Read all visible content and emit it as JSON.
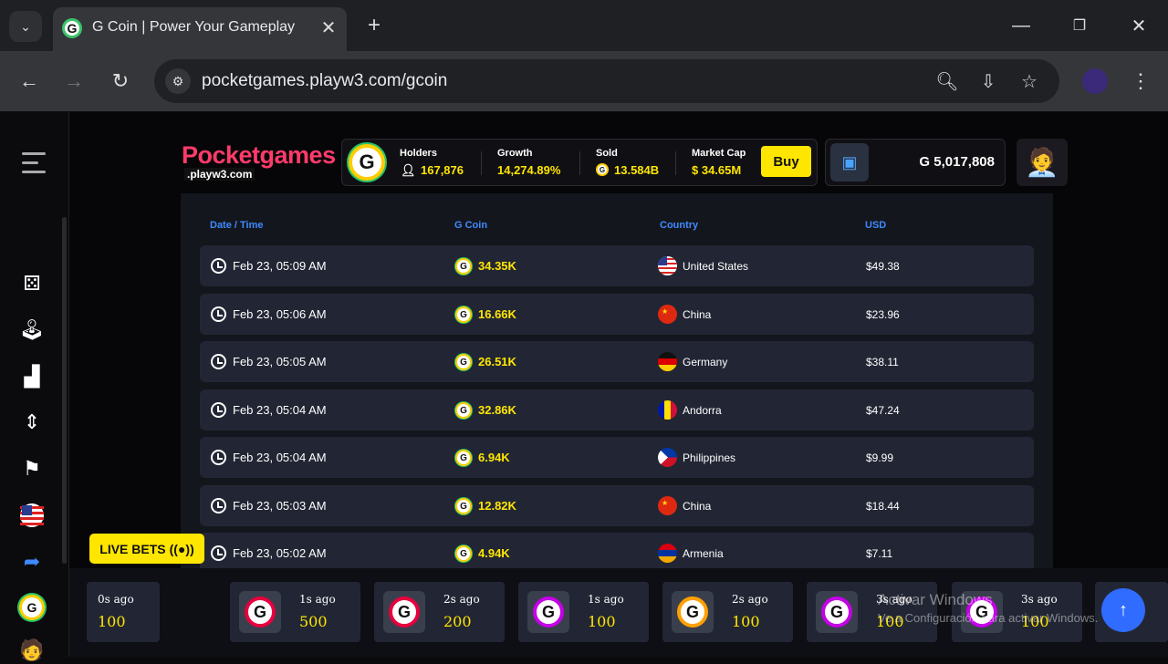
{
  "browser": {
    "tab_title": "G Coin | Power Your Gameplay",
    "url": "pocketgames.playw3.com/gcoin"
  },
  "header": {
    "logo_main": "Pocketgames",
    "logo_sub": ".playw3.com",
    "stats": {
      "holders_label": "Holders",
      "holders_value": "167,876",
      "growth_label": "Growth",
      "growth_value": "14,274.89%",
      "sold_label": "Sold",
      "sold_value": "13.584B",
      "marketcap_label": "Market Cap",
      "marketcap_value": "$ 34.65M"
    },
    "buy_label": "Buy",
    "wallet_balance": "G 5,017,808"
  },
  "table": {
    "headers": [
      "Date / Time",
      "G Coin",
      "Country",
      "USD"
    ],
    "rows": [
      {
        "date": "Feb 23, 05:09 AM",
        "coin": "34.35K",
        "country": "United States",
        "usd": "$49.38"
      },
      {
        "date": "Feb 23, 05:06 AM",
        "coin": "16.66K",
        "country": "China",
        "usd": "$23.96"
      },
      {
        "date": "Feb 23, 05:05 AM",
        "coin": "26.51K",
        "country": "Germany",
        "usd": "$38.11"
      },
      {
        "date": "Feb 23, 05:04 AM",
        "coin": "32.86K",
        "country": "Andorra",
        "usd": "$47.24"
      },
      {
        "date": "Feb 23, 05:04 AM",
        "coin": "6.94K",
        "country": "Philippines",
        "usd": "$9.99"
      },
      {
        "date": "Feb 23, 05:03 AM",
        "coin": "12.82K",
        "country": "China",
        "usd": "$18.44"
      },
      {
        "date": "Feb 23, 05:02 AM",
        "coin": "4.94K",
        "country": "Armenia",
        "usd": "$7.11"
      }
    ]
  },
  "live_bets_label": "LIVE BETS",
  "ticker": [
    {
      "ago": "0s ago",
      "value": "100",
      "color": "#ffcc00"
    },
    {
      "ago": "1s ago",
      "value": "500",
      "color": "#e6003e"
    },
    {
      "ago": "2s ago",
      "value": "200",
      "color": "#e6003e"
    },
    {
      "ago": "1s ago",
      "value": "100",
      "color": "#c400e6"
    },
    {
      "ago": "2s ago",
      "value": "100",
      "color": "#ffa000"
    },
    {
      "ago": "3s ago",
      "value": "100",
      "color": "#c400e6"
    },
    {
      "ago": "3s ago",
      "value": "100",
      "color": "#c400e6"
    }
  ],
  "watermark": {
    "line1": "Activar Windows",
    "line2": "Ve a Configuración para activar Windows."
  }
}
